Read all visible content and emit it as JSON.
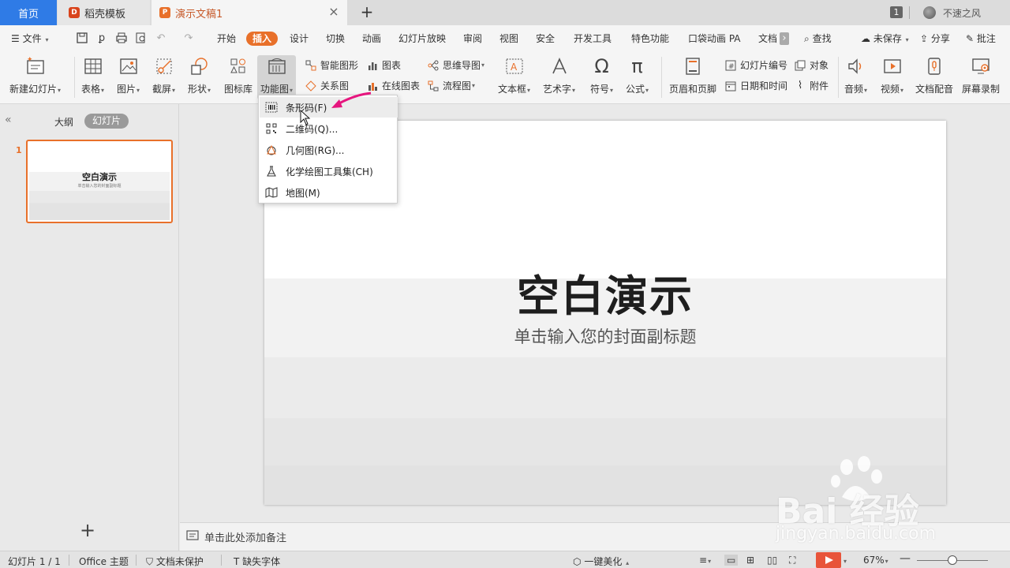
{
  "tabs": {
    "home": "首页",
    "template": "稻壳模板",
    "document": "演示文稿1",
    "add_icon": "plus-icon",
    "close_icon": "close-icon"
  },
  "window": {
    "window_count": "1",
    "user_name": "不速之风"
  },
  "menubar": {
    "file": "文件",
    "items": [
      "开始",
      "插入",
      "设计",
      "切换",
      "动画",
      "幻灯片放映",
      "审阅",
      "视图",
      "安全",
      "开发工具",
      "特色功能",
      "口袋动画 PA",
      "文档"
    ],
    "active": "插入",
    "search": "查找",
    "unsaved": "未保存",
    "share": "分享",
    "comment": "批注"
  },
  "ribbon": {
    "new_slide": "新建幻灯片",
    "table": "表格",
    "picture": "图片",
    "screenshot": "截屏",
    "shape": "形状",
    "icon_lib": "图标库",
    "function_chart": "功能图",
    "smart_shape": "智能图形",
    "chart": "图表",
    "relation": "关系图",
    "online_chart": "在线图表",
    "mindmap": "思维导图",
    "flowchart": "流程图",
    "textbox": "文本框",
    "wordart": "艺术字",
    "symbol": "符号",
    "formula": "公式",
    "header_footer": "页眉和页脚",
    "slide_number": "幻灯片编号",
    "object": "对象",
    "date_time": "日期和时间",
    "attachment": "附件",
    "audio": "音频",
    "video": "视频",
    "narration": "文档配音",
    "screen_record": "屏幕录制"
  },
  "leftpanel": {
    "outline": "大纲",
    "slides": "幻灯片",
    "slide_number": "1",
    "thumb_title": "空白演示",
    "thumb_subtitle": "单击输入您的封面副标题"
  },
  "slide": {
    "title": "空白演示",
    "subtitle": "单击输入您的封面副标题"
  },
  "notes": {
    "placeholder": "单击此处添加备注"
  },
  "dropdown": {
    "items": [
      {
        "label": "条形码(F)",
        "icon": "barcode-icon"
      },
      {
        "label": "二维码(Q)...",
        "icon": "qrcode-icon"
      },
      {
        "label": "几何图(RG)...",
        "icon": "geometry-icon"
      },
      {
        "label": "化学绘图工具集(CH)",
        "icon": "flask-icon"
      },
      {
        "label": "地图(M)",
        "icon": "map-icon"
      }
    ]
  },
  "statusbar": {
    "slide_count": "幻灯片 1 / 1",
    "theme": "Office 主题",
    "protection": "文档未保护",
    "missing_font": "缺失字体",
    "beautify": "一键美化",
    "zoom": "67%"
  },
  "watermark": {
    "brand": "Bai  经验",
    "url": "jingyan.baidu.com"
  },
  "colors": {
    "accent": "#e8702a",
    "home_tab": "#2f7be6",
    "play": "#e8543a",
    "arrow": "#e6157e"
  }
}
